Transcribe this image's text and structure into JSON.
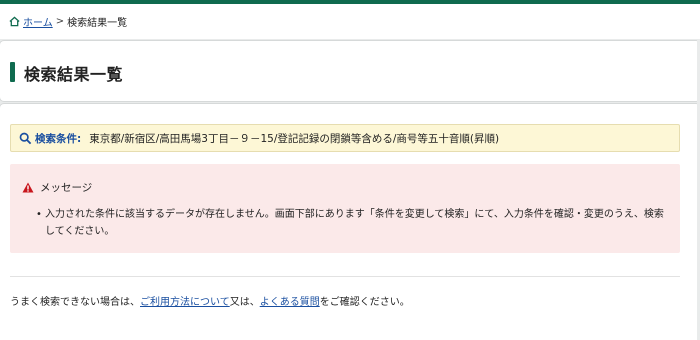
{
  "breadcrumb": {
    "home_label": "ホーム",
    "separator": ">",
    "current": "検索結果一覧"
  },
  "page": {
    "title": "検索結果一覧"
  },
  "condition": {
    "label": "検索条件:",
    "value": "東京都/新宿区/高田馬場3丁目－９－15/登記記録の閉鎖等含める/商号等五十音順(昇順)"
  },
  "message": {
    "heading": "メッセージ",
    "items": [
      "入力された条件に該当するデータが存在しません。画面下部にあります「条件を変更して検索」にて、入力条件を確認・変更のうえ、検索してください。"
    ]
  },
  "help": {
    "prefix": "うまく検索できない場合は、",
    "link1": "ご利用方法について",
    "middle": "又は、",
    "link2": "よくある質問",
    "suffix": "をご確認ください。"
  },
  "icons": {
    "home": "home-icon",
    "search": "search-icon",
    "warning": "warning-icon"
  },
  "colors": {
    "brand": "#0f6b4f",
    "link": "#1a4fa0",
    "condition_bg": "#fdf7d6",
    "message_bg": "#fbe9e9",
    "warning": "#c8161d"
  }
}
